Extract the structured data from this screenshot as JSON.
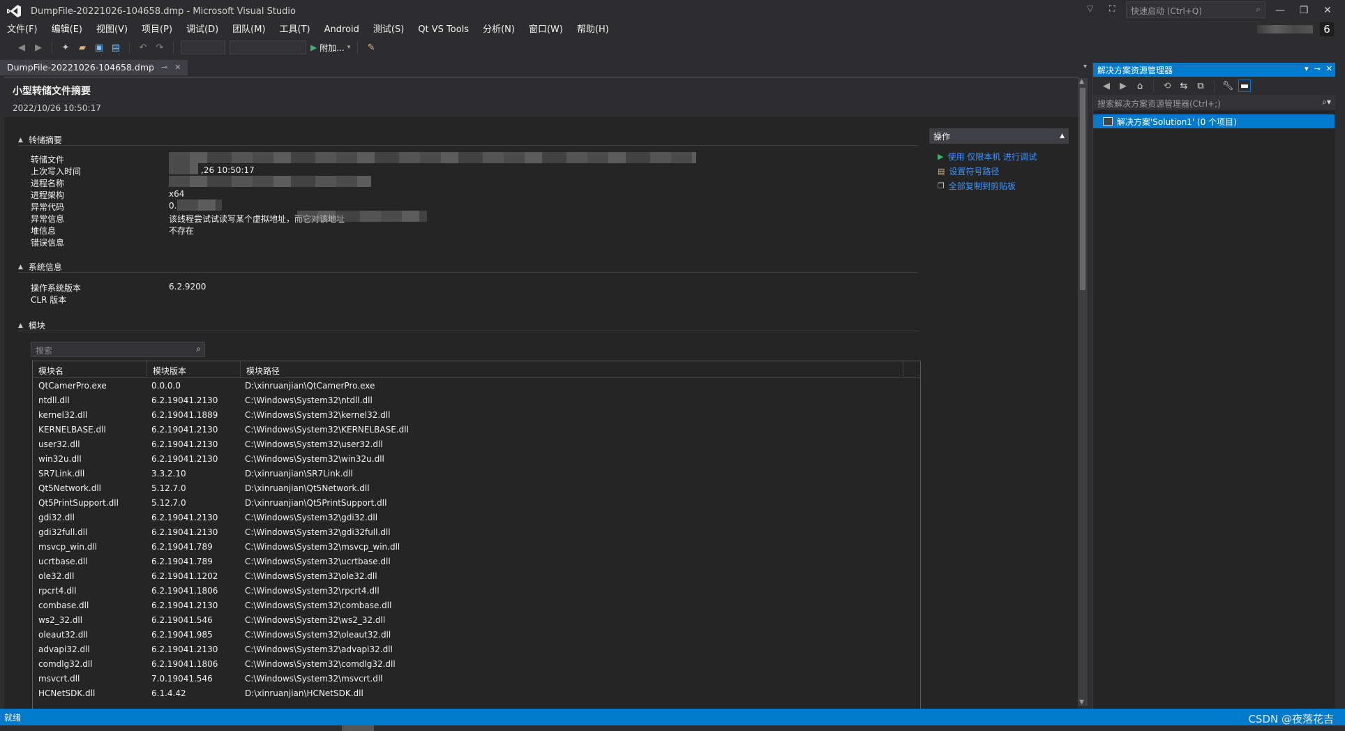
{
  "window": {
    "title": "DumpFile-20221026-104658.dmp - Microsoft Visual Studio",
    "quick_launch_placeholder": "快速启动 (Ctrl+Q)",
    "notification_count": "6"
  },
  "menu": [
    "文件(F)",
    "编辑(E)",
    "视图(V)",
    "项目(P)",
    "调试(D)",
    "团队(M)",
    "工具(T)",
    "Android",
    "测试(S)",
    "Qt VS Tools",
    "分析(N)",
    "窗口(W)",
    "帮助(H)"
  ],
  "toolbar": {
    "attach_label": "附加..."
  },
  "doc_tab": {
    "label": "DumpFile-20221026-104658.dmp"
  },
  "doc": {
    "title": "小型转储文件摘要",
    "date": "2022/10/26 10:50:17",
    "dump_summary": {
      "heading": "转储摘要",
      "rows": [
        {
          "label": "转储文件",
          "value": ""
        },
        {
          "label": "上次写入时间",
          "value": ",26 10:50:17"
        },
        {
          "label": "进程名称",
          "value": ""
        },
        {
          "label": "进程架构",
          "value": "x64"
        },
        {
          "label": "异常代码",
          "value": "0."
        },
        {
          "label": "异常信息",
          "value": "该线程尝试试读写某个虚拟地址，而它对该地址"
        },
        {
          "label": "堆信息",
          "value": "不存在"
        },
        {
          "label": "错误信息",
          "value": ""
        }
      ]
    },
    "system_info": {
      "heading": "系统信息",
      "rows": [
        {
          "label": "操作系统版本",
          "value": "6.2.9200"
        },
        {
          "label": "CLR 版本",
          "value": ""
        }
      ]
    },
    "modules": {
      "heading": "模块",
      "search_placeholder": "搜索",
      "columns": [
        "模块名",
        "模块版本",
        "模块路径"
      ],
      "rows": [
        [
          "QtCamerPro.exe",
          "0.0.0.0",
          "D:\\xinruanjian\\QtCamerPro.exe"
        ],
        [
          "ntdll.dll",
          "6.2.19041.2130",
          "C:\\Windows\\System32\\ntdll.dll"
        ],
        [
          "kernel32.dll",
          "6.2.19041.1889",
          "C:\\Windows\\System32\\kernel32.dll"
        ],
        [
          "KERNELBASE.dll",
          "6.2.19041.2130",
          "C:\\Windows\\System32\\KERNELBASE.dll"
        ],
        [
          "user32.dll",
          "6.2.19041.2130",
          "C:\\Windows\\System32\\user32.dll"
        ],
        [
          "win32u.dll",
          "6.2.19041.2130",
          "C:\\Windows\\System32\\win32u.dll"
        ],
        [
          "SR7Link.dll",
          "3.3.2.10",
          "D:\\xinruanjian\\SR7Link.dll"
        ],
        [
          "Qt5Network.dll",
          "5.12.7.0",
          "D:\\xinruanjian\\Qt5Network.dll"
        ],
        [
          "Qt5PrintSupport.dll",
          "5.12.7.0",
          "D:\\xinruanjian\\Qt5PrintSupport.dll"
        ],
        [
          "gdi32.dll",
          "6.2.19041.2130",
          "C:\\Windows\\System32\\gdi32.dll"
        ],
        [
          "gdi32full.dll",
          "6.2.19041.2130",
          "C:\\Windows\\System32\\gdi32full.dll"
        ],
        [
          "msvcp_win.dll",
          "6.2.19041.789",
          "C:\\Windows\\System32\\msvcp_win.dll"
        ],
        [
          "ucrtbase.dll",
          "6.2.19041.789",
          "C:\\Windows\\System32\\ucrtbase.dll"
        ],
        [
          "ole32.dll",
          "6.2.19041.1202",
          "C:\\Windows\\System32\\ole32.dll"
        ],
        [
          "rpcrt4.dll",
          "6.2.19041.1806",
          "C:\\Windows\\System32\\rpcrt4.dll"
        ],
        [
          "combase.dll",
          "6.2.19041.2130",
          "C:\\Windows\\System32\\combase.dll"
        ],
        [
          "ws2_32.dll",
          "6.2.19041.546",
          "C:\\Windows\\System32\\ws2_32.dll"
        ],
        [
          "oleaut32.dll",
          "6.2.19041.985",
          "C:\\Windows\\System32\\oleaut32.dll"
        ],
        [
          "advapi32.dll",
          "6.2.19041.2130",
          "C:\\Windows\\System32\\advapi32.dll"
        ],
        [
          "comdlg32.dll",
          "6.2.19041.1806",
          "C:\\Windows\\System32\\comdlg32.dll"
        ],
        [
          "msvcrt.dll",
          "7.0.19041.546",
          "C:\\Windows\\System32\\msvcrt.dll"
        ],
        [
          "HCNetSDK.dll",
          "6.1.4.42",
          "D:\\xinruanjian\\HCNetSDK.dll"
        ]
      ]
    }
  },
  "actions": {
    "heading": "操作",
    "links": [
      "使用 仅限本机 进行调试",
      "设置符号路径",
      "全部复制到剪贴板"
    ]
  },
  "solution_explorer": {
    "title": "解决方案资源管理器",
    "search_placeholder": "搜索解决方案资源管理器(Ctrl+;)",
    "solution_node": "解决方案'Solution1' (0 个项目)"
  },
  "status": {
    "text": "就绪",
    "watermark": "CSDN @夜落花吉"
  },
  "colors": {
    "accent": "#007acc",
    "link": "#3794ff",
    "background": "#2d2d30"
  }
}
